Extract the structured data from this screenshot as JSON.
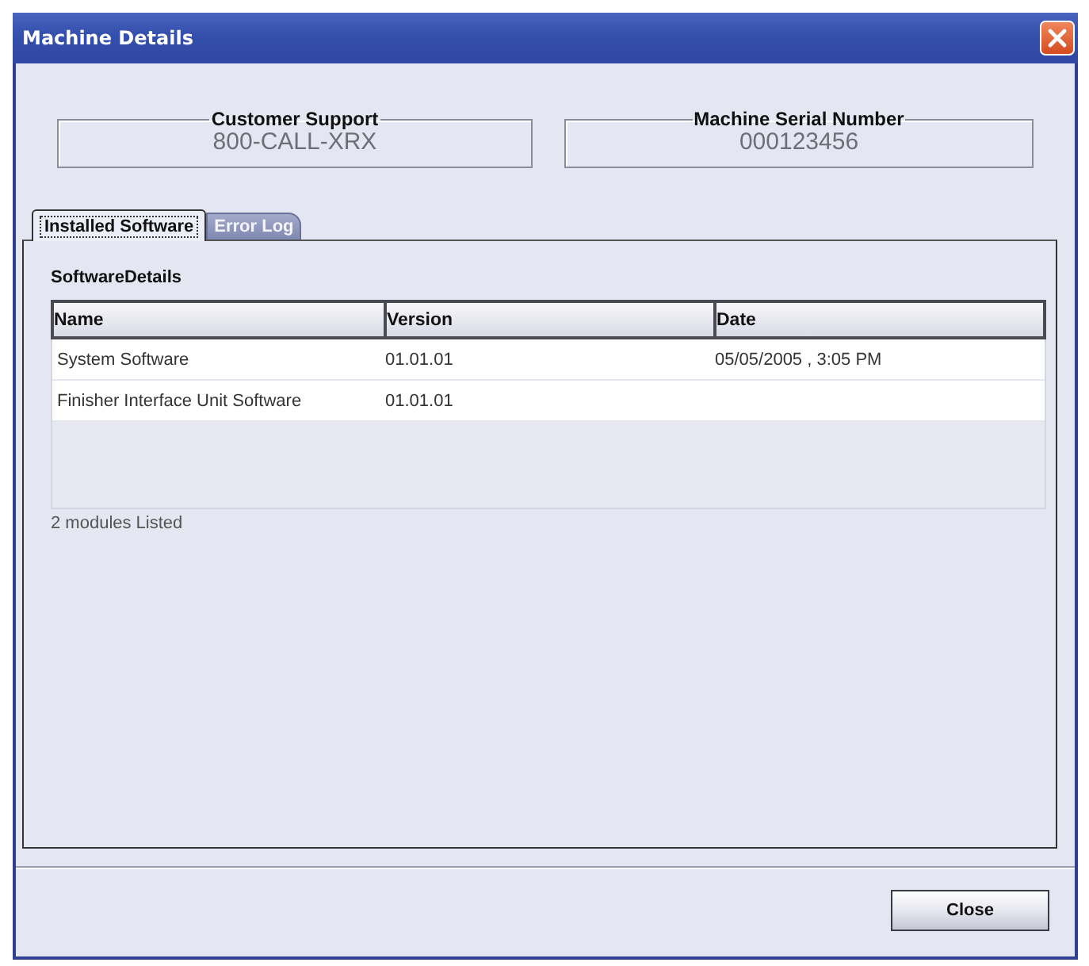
{
  "window": {
    "title": "Machine Details"
  },
  "info_boxes": [
    {
      "label": "Customer Support",
      "value": "800-CALL-XRX"
    },
    {
      "label": "Machine Serial Number",
      "value": "000123456"
    }
  ],
  "tabs": [
    {
      "label": "Installed Software",
      "selected": true
    },
    {
      "label": "Error Log",
      "selected": false
    }
  ],
  "section_title": "SoftwareDetails",
  "table": {
    "columns": [
      "Name",
      "Version",
      "Date"
    ],
    "rows": [
      [
        "System Software",
        "01.01.01",
        "05/05/2005 , 3:05 PM"
      ],
      [
        "Finisher Interface Unit Software",
        "01.01.01"
      ]
    ]
  },
  "status_text": "2 modules Listed",
  "buttons": [
    {
      "label": "Close"
    }
  ]
}
